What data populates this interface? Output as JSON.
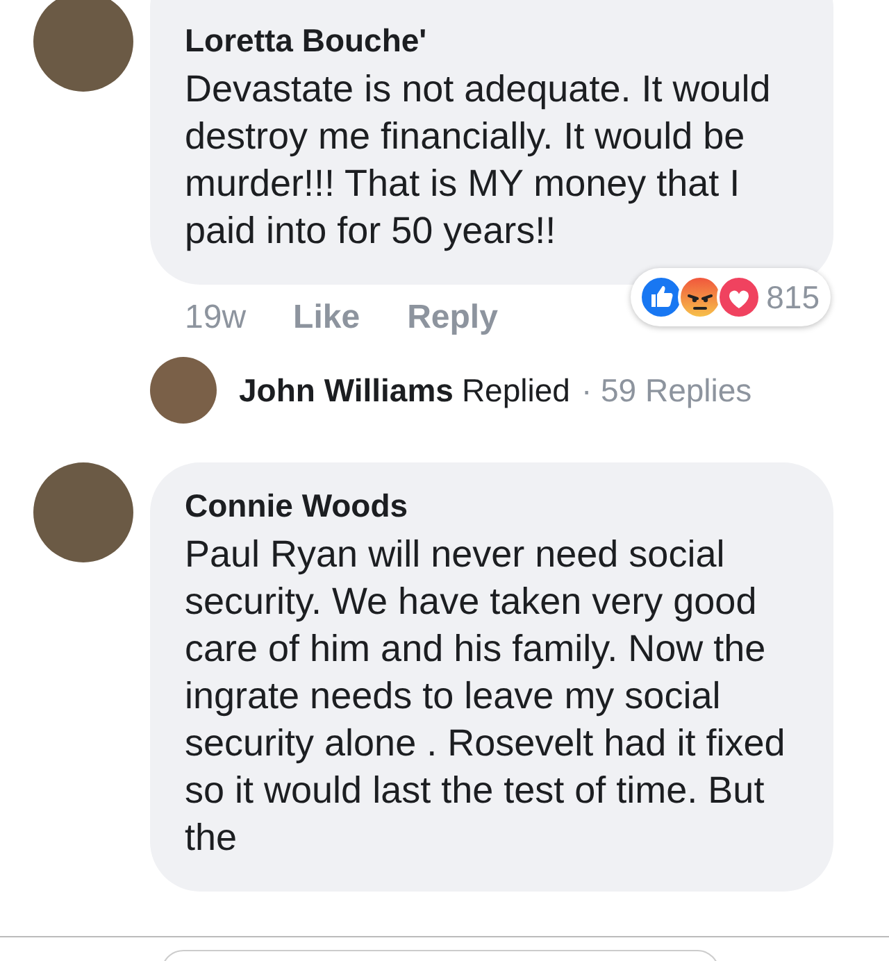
{
  "comments": [
    {
      "author": "Loretta Bouche'",
      "text": "Devastate is not adequate. It would destroy me financially. It would be murder!!! That is MY money that I paid into for 50 years!!",
      "time": "19w",
      "actions": [
        "Like",
        "Reply"
      ],
      "reactions": [
        {
          "kind": "like"
        },
        {
          "kind": "angry"
        },
        {
          "kind": "love"
        }
      ],
      "reaction_count": "815",
      "reply_summary": {
        "author": "John Williams",
        "verb": "Replied",
        "count": "· 59 Replies"
      }
    },
    {
      "author": "Connie Woods",
      "text": "Paul Ryan will never need social security. We have taken very good care of him and his family. Now the ingrate needs to leave my social security alone . Rosevelt had it fixed so it would last the test of time. But the"
    }
  ]
}
